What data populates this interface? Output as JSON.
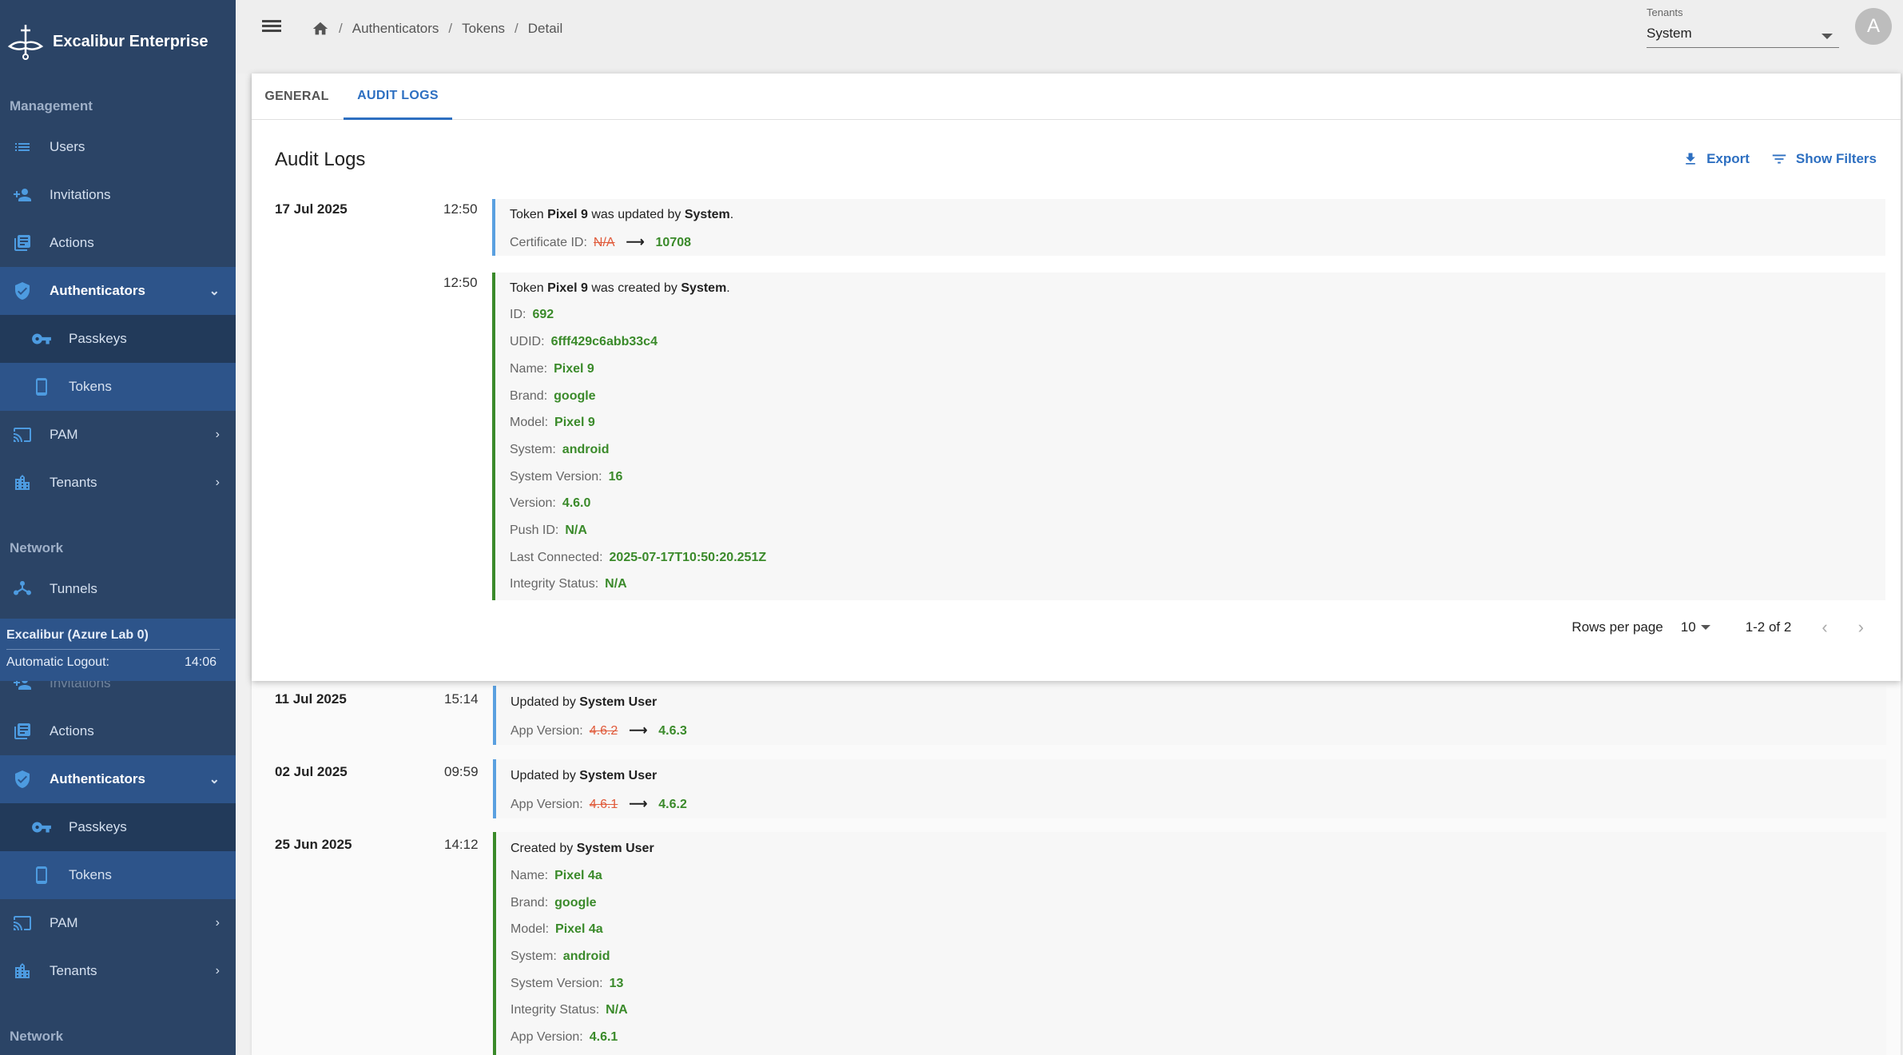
{
  "app": {
    "name": "Excalibur Enterprise"
  },
  "sidebar": {
    "sections": {
      "management": "Management",
      "network": "Network"
    },
    "items": {
      "users": "Users",
      "invitations": "Invitations",
      "actions": "Actions",
      "authenticators": "Authenticators",
      "passkeys": "Passkeys",
      "tokens": "Tokens",
      "pam": "PAM",
      "tenants": "Tenants",
      "tunnels": "Tunnels"
    },
    "environment": {
      "name": "Excalibur (Azure Lab 0)",
      "logout_label": "Automatic Logout:",
      "logout_time": "14:06"
    }
  },
  "topbar": {
    "breadcrumb": [
      "Authenticators",
      "Tokens",
      "Detail"
    ],
    "tenant_select": {
      "label": "Tenants",
      "value": "System"
    },
    "avatar_letter": "A"
  },
  "card": {
    "tabs": [
      "GENERAL",
      "AUDIT LOGS"
    ],
    "title": "Audit Logs",
    "export_label": "Export",
    "filters_label": "Show Filters"
  },
  "logs": {
    "day1": {
      "date": "17 Jul 2025"
    },
    "e1": {
      "time": "12:50",
      "pre": "Token",
      "subject": "Pixel 9",
      "mid": "was updated by",
      "actor": "System",
      "end": ".",
      "field": "Certificate ID:",
      "old": "N/A",
      "new": "10708"
    },
    "e2": {
      "time": "12:50",
      "pre": "Token",
      "subject": "Pixel 9",
      "mid": "was created by",
      "actor": "System",
      "end": ".",
      "fields": [
        {
          "label": "ID:",
          "value": "692"
        },
        {
          "label": "UDID:",
          "value": "6fff429c6abb33c4"
        },
        {
          "label": "Name:",
          "value": "Pixel 9"
        },
        {
          "label": "Brand:",
          "value": "google"
        },
        {
          "label": "Model:",
          "value": "Pixel 9"
        },
        {
          "label": "System:",
          "value": "android"
        },
        {
          "label": "System Version:",
          "value": "16"
        },
        {
          "label": "Version:",
          "value": "4.6.0"
        },
        {
          "label": "Push ID:",
          "value": "N/A"
        },
        {
          "label": "Last Connected:",
          "value": "2025-07-17T10:50:20.251Z"
        },
        {
          "label": "Integrity Status:",
          "value": "N/A"
        }
      ]
    },
    "bg1": {
      "date": "11 Jul 2025",
      "time": "15:14",
      "pre": "Updated by",
      "actor": "System User",
      "field": "App Version:",
      "old": "4.6.2",
      "new": "4.6.3"
    },
    "bg2": {
      "date": "02 Jul 2025",
      "time": "09:59",
      "pre": "Updated by",
      "actor": "System User",
      "field": "App Version:",
      "old": "4.6.1",
      "new": "4.6.2"
    },
    "bg3": {
      "date": "25 Jun 2025",
      "time": "14:12",
      "pre": "Created by",
      "actor": "System User",
      "fields": [
        {
          "label": "Name:",
          "value": "Pixel 4a"
        },
        {
          "label": "Brand:",
          "value": "google"
        },
        {
          "label": "Model:",
          "value": "Pixel 4a"
        },
        {
          "label": "System:",
          "value": "android"
        },
        {
          "label": "System Version:",
          "value": "13"
        },
        {
          "label": "Integrity Status:",
          "value": "N/A"
        },
        {
          "label": "App Version:",
          "value": "4.6.1"
        }
      ]
    }
  },
  "pagination": {
    "rows_label": "Rows per page",
    "rows_value": "10",
    "range": "1-2 of 2"
  },
  "colors": {
    "sidebar": "#2b4466",
    "accent": "#2d6fc1",
    "created_border": "#3a8a2a",
    "updated_border": "#5aa0e0",
    "old_value": "#e05a3a",
    "new_value": "#3a8a2a"
  }
}
